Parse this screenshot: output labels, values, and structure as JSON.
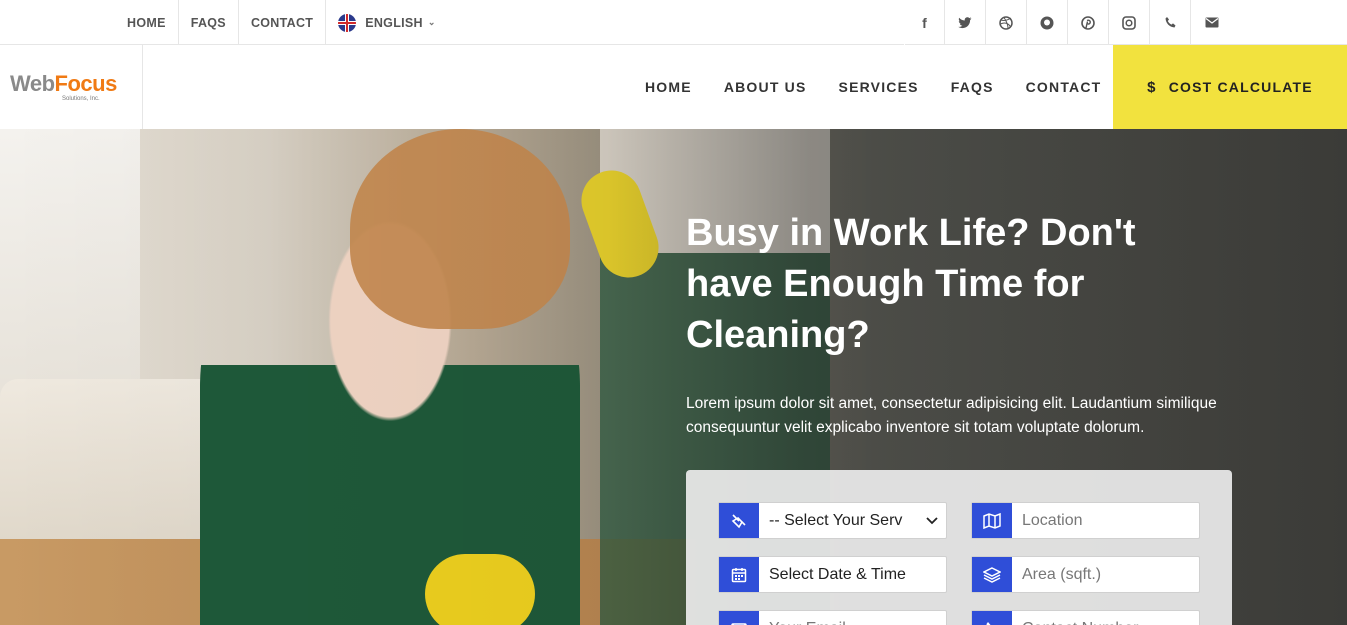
{
  "topbar": {
    "links": [
      "HOME",
      "FAQS",
      "CONTACT"
    ],
    "language": "ENGLISH",
    "social_icons": [
      "facebook-icon",
      "twitter-icon",
      "dribbble-icon",
      "github-icon",
      "pinterest-icon",
      "instagram-icon",
      "phone-icon",
      "envelope-icon"
    ]
  },
  "header": {
    "logo": {
      "part1": "Web",
      "part2": "Focus",
      "sub": "Solutions, Inc."
    },
    "nav": [
      "HOME",
      "ABOUT US",
      "SERVICES",
      "FAQS",
      "CONTACT"
    ],
    "cta_label": "COST CALCULATE",
    "cta_color": "#f2e23e"
  },
  "hero": {
    "headline": "Busy in Work Life? Don't have Enough Time for Cleaning?",
    "text": "Lorem ipsum dolor sit amet, consectetur adipisicing elit. Laudantium similique consequuntur velit explicabo inventore sit totam voluptate dolorum."
  },
  "form": {
    "accent": "#2f4ed8",
    "service_select": "-- Select Your Serv",
    "location_placeholder": "Location",
    "datetime_value": "Select Date & Time",
    "area_placeholder": "Area (sqft.)",
    "email_placeholder": "Your Email",
    "number_placeholder": "Contact Number"
  }
}
